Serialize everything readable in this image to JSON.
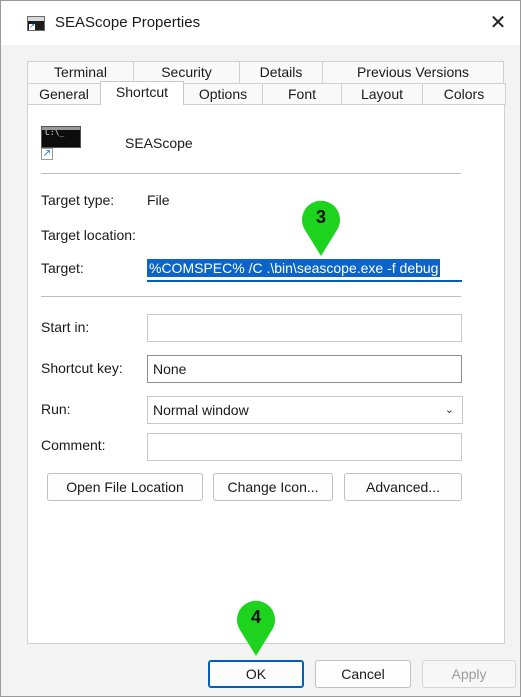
{
  "window": {
    "title": "SEAScope Properties",
    "close_glyph": "✕"
  },
  "tabs": {
    "row1": [
      "Terminal",
      "Security",
      "Details",
      "Previous Versions"
    ],
    "row2": [
      "General",
      "Shortcut",
      "Options",
      "Font",
      "Layout",
      "Colors"
    ],
    "active": "Shortcut"
  },
  "shortcut": {
    "name": "SEAScope",
    "icon_text": "C:\\_",
    "target_type_label": "Target type:",
    "target_type_value": "File",
    "target_location_label": "Target location:",
    "target_label": "Target:",
    "target_value": "%COMSPEC% /C .\\bin\\seascope.exe -f debug",
    "start_in_label": "Start in:",
    "start_in_value": "",
    "shortcut_key_label": "Shortcut key:",
    "shortcut_key_value": "None",
    "run_label": "Run:",
    "run_value": "Normal window",
    "comment_label": "Comment:",
    "comment_value": ""
  },
  "buttons": {
    "open_file_location": "Open File Location",
    "change_icon": "Change Icon...",
    "advanced": "Advanced...",
    "ok": "OK",
    "cancel": "Cancel",
    "apply": "Apply"
  },
  "markers": {
    "step3": "3",
    "step4": "4",
    "color": "#1ed31e"
  }
}
